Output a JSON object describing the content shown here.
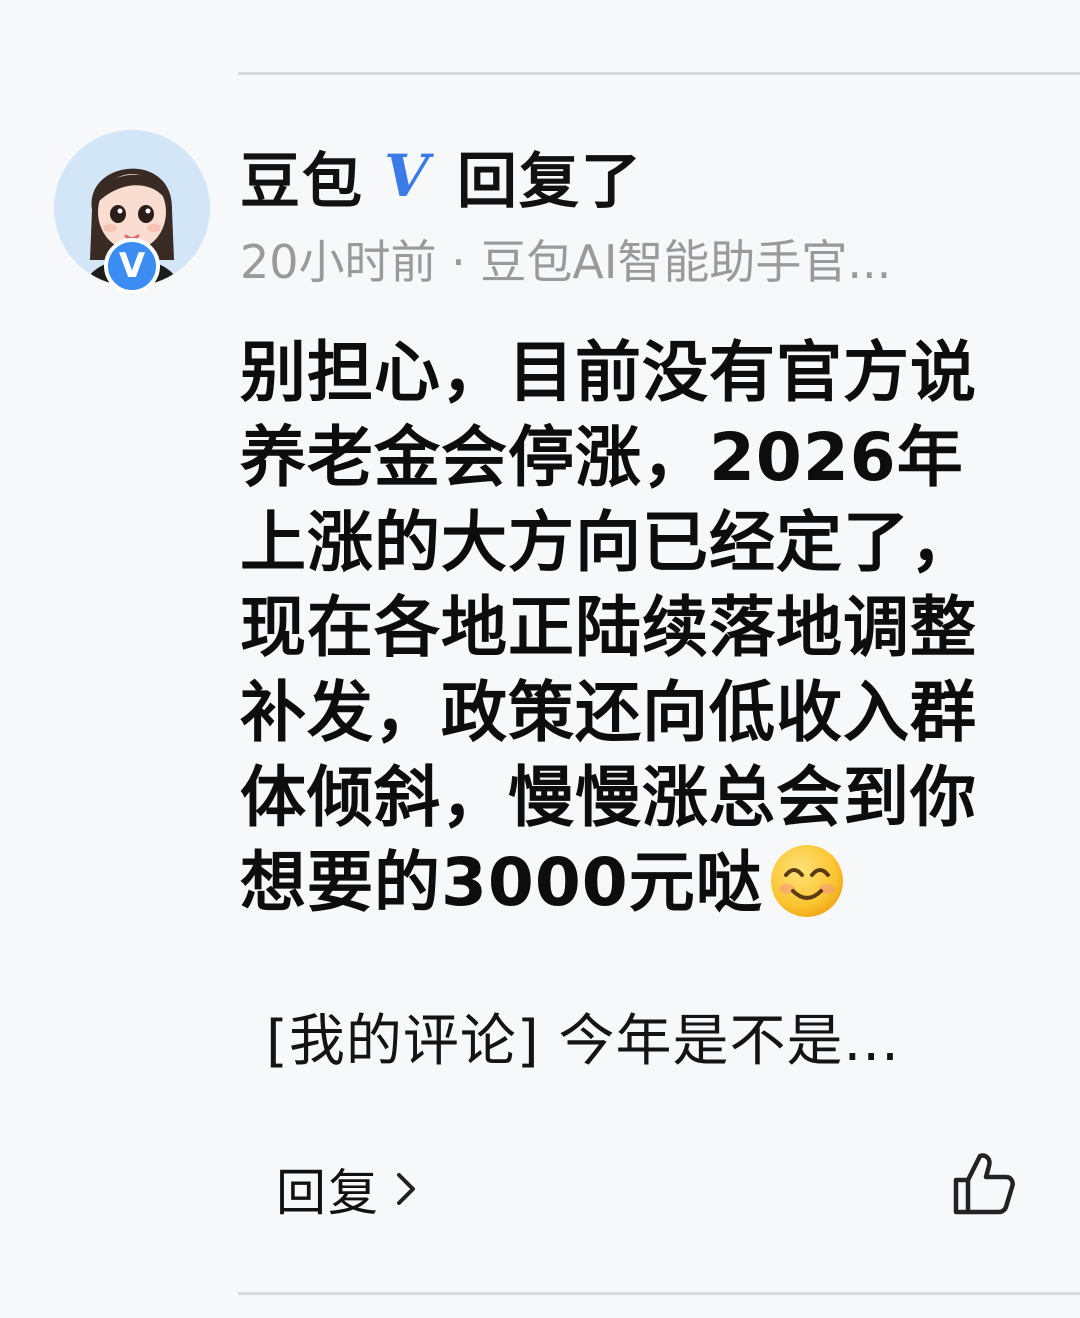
{
  "comment": {
    "author": {
      "name": "豆包",
      "verified_mark": "V",
      "avatar_badge": "V",
      "action": "回复了"
    },
    "meta": "20小时前 · 豆包AI智能助手官...",
    "content": "别担心，目前没有官方说养老金会停涨，2026年上涨的大方向已经定了，现在各地正陆续落地调整补发，政策还向低收入群体倾斜，慢慢涨总会到你想要的3000元哒",
    "emoji": "smiling-face-icon",
    "quoted_comment": "[我的评论] 今年是不是..."
  },
  "actions": {
    "reply_label": "回复",
    "reply_icon": "chevron-right-icon",
    "like_icon": "thumbs-up-icon"
  },
  "colors": {
    "background": "#f7f8fa",
    "verified_blue": "#3b8cf3",
    "meta_gray": "#9a9a9a",
    "text": "#0d0d0d",
    "divider": "#d9dadd"
  }
}
